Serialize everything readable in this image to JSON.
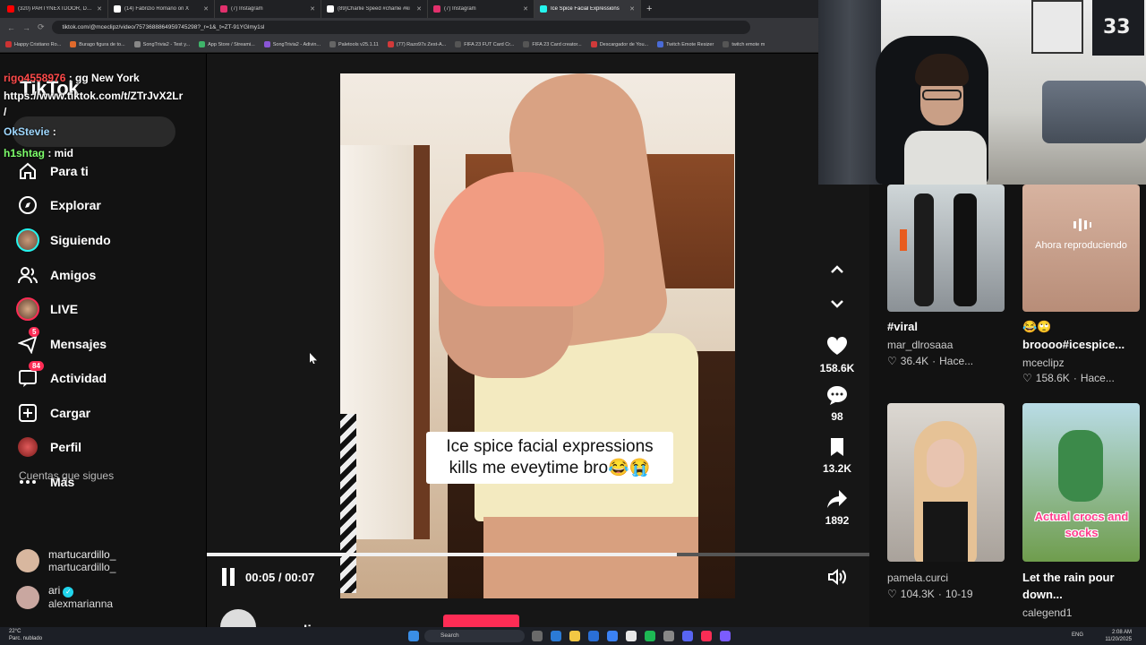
{
  "browser": {
    "tabs": [
      {
        "label": "(320) PARTYNEXTDOOR, Drake",
        "color": "#ff0000"
      },
      {
        "label": "(14) Fabrizio Romano on X",
        "color": "#ffffff"
      },
      {
        "label": "(7) Instagram",
        "color": "#e1306c"
      },
      {
        "label": "(89)Charlie Speed #charlie #ki",
        "color": "#ffffff"
      },
      {
        "label": "(7) Instagram",
        "color": "#e1306c"
      },
      {
        "label": "Ice Spice Facial Expressions",
        "color": "#25f4ee"
      }
    ],
    "url": "tiktok.com/@mceclipz/video/7573688864959745298?_r=1&_t=ZT-91YGlmy1sl",
    "bookmarks": [
      "Happy Cristiano Ro...",
      "Burago figura de to...",
      "SongTrivia2 - Test y...",
      "App Store / Streami...",
      "SongTrivia2 - Adivin...",
      "Paletools v25.1.11",
      "(77) Razo97s Zest-A...",
      "FIFA 23 FUT Card Cr...",
      "FIFA 23 Card creator...",
      "Descargador de You...",
      "Twitch Emote Resizer",
      "twitch emote m"
    ]
  },
  "chat": [
    {
      "user": "rigo4558976",
      "text": ": gg New York",
      "color": "#ff4a4a"
    },
    {
      "user": "",
      "text": "https://www.tiktok.com/t/ZTrJvX2Lr",
      "color": "#ffffff"
    },
    {
      "user": "",
      "text": "/",
      "color": "#ffffff"
    },
    {
      "user": "OkStevie",
      "text": ":",
      "color": "#9fd8ff"
    },
    {
      "user": "h1shtag",
      "text": ": mid",
      "color": "#7dff6b"
    }
  ],
  "sidebar": {
    "logo": "TikTok",
    "nav": [
      {
        "label": "Para ti",
        "icon": "home-icon"
      },
      {
        "label": "Explorar",
        "icon": "compass-icon"
      },
      {
        "label": "Siguiendo",
        "icon": "following-avatar-icon"
      },
      {
        "label": "Amigos",
        "icon": "friends-icon"
      },
      {
        "label": "LIVE",
        "icon": "live-avatar-icon"
      },
      {
        "label": "Mensajes",
        "icon": "message-icon",
        "badge": "5"
      },
      {
        "label": "Actividad",
        "icon": "activity-icon",
        "badge": "84"
      },
      {
        "label": "Cargar",
        "icon": "upload-icon"
      },
      {
        "label": "Perfil",
        "icon": "profile-icon"
      },
      {
        "label": "Más",
        "icon": "more-icon"
      }
    ],
    "following_title": "Cuentas que sigues",
    "accounts": [
      {
        "name": "martucardillo_",
        "username": "martucardillo_"
      },
      {
        "name": "ari",
        "username": "alexmarianna",
        "verified": true
      }
    ]
  },
  "video": {
    "caption_line1": "Ice spice facial expressions",
    "caption_line2": "kills me eveytime bro😂😭",
    "time": "00:05 / 00:07",
    "progress": 0.71,
    "author": "mceclipz",
    "likes": "158.6K",
    "comments": "98",
    "saves": "13.2K",
    "shares": "1892"
  },
  "related": [
    {
      "title": "#viral",
      "user": "mar_dlrosaaa",
      "likes": "36.4K",
      "time": "Hace..."
    },
    {
      "title": "😂🙄",
      "title2": "broooo#icespice...",
      "user": "mceclipz",
      "likes": "158.6K",
      "time": "Hace...",
      "now_playing": "Ahora reproduciendo"
    },
    {
      "title": "",
      "user": "pamela.curci",
      "likes": "104.3K",
      "time": "10-19"
    },
    {
      "title": "Let the rain pour",
      "title2": "down...",
      "user": "calegend1",
      "overlay": "Actual crocs and socks"
    }
  ],
  "taskbar": {
    "weather_temp": "22°C",
    "weather_desc": "Parc. nublado",
    "search": "Search",
    "lang": "ENG",
    "time": "2:08 AM",
    "date": "11/20/2025"
  },
  "cam": {
    "jersey": "33"
  }
}
